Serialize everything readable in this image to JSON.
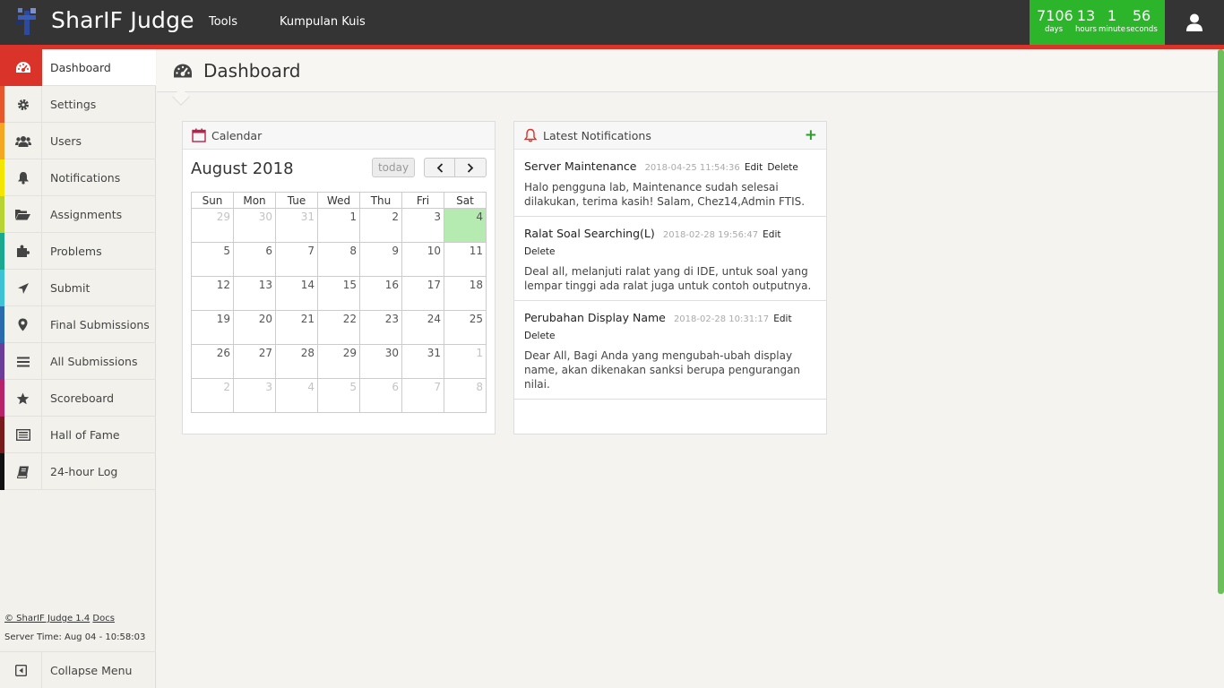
{
  "app": {
    "title": "SharIF Judge",
    "nav": [
      "Tools",
      "Kumpulan Kuis"
    ]
  },
  "countdown": {
    "days": "7106",
    "days_label": "days",
    "hours": "13",
    "hours_label": "hours",
    "minutes": "1",
    "minutes_label": "minute",
    "seconds": "56",
    "seconds_label": "seconds"
  },
  "sidebar": {
    "items": [
      {
        "label": "Dashboard",
        "icon": "dashboard-icon",
        "color": "#d9332a"
      },
      {
        "label": "Settings",
        "icon": "gear-icon",
        "color": "#e8572c"
      },
      {
        "label": "Users",
        "icon": "users-icon",
        "color": "#f5a623"
      },
      {
        "label": "Notifications",
        "icon": "bell-icon",
        "color": "#f4e600"
      },
      {
        "label": "Assignments",
        "icon": "folder-open-icon",
        "color": "#b7d334"
      },
      {
        "label": "Problems",
        "icon": "puzzle-icon",
        "color": "#1aa88f"
      },
      {
        "label": "Submit",
        "icon": "paper-plane-icon",
        "color": "#3ec3d6"
      },
      {
        "label": "Final Submissions",
        "icon": "map-marker-icon",
        "color": "#2a6bb0"
      },
      {
        "label": "All Submissions",
        "icon": "list-icon",
        "color": "#6a3d9a"
      },
      {
        "label": "Scoreboard",
        "icon": "star-icon",
        "color": "#b7226a"
      },
      {
        "label": "Hall of Fame",
        "icon": "newspaper-icon",
        "color": "#7a1b1b"
      },
      {
        "label": "24-hour Log",
        "icon": "book-icon",
        "color": "#111111"
      }
    ],
    "footer_copy": "© SharIF Judge 1.4",
    "footer_docs": "Docs",
    "server_time": "Server Time: Aug 04 - 10:58:03",
    "collapse_label": "Collapse Menu"
  },
  "page": {
    "title": "Dashboard"
  },
  "calendar": {
    "widget_title": "Calendar",
    "month": "August 2018",
    "today_label": "today",
    "weekdays": [
      "Sun",
      "Mon",
      "Tue",
      "Wed",
      "Thu",
      "Fri",
      "Sat"
    ],
    "weeks": [
      [
        "29",
        "30",
        "31",
        "1",
        "2",
        "3",
        "4"
      ],
      [
        "5",
        "6",
        "7",
        "8",
        "9",
        "10",
        "11"
      ],
      [
        "12",
        "13",
        "14",
        "15",
        "16",
        "17",
        "18"
      ],
      [
        "19",
        "20",
        "21",
        "22",
        "23",
        "24",
        "25"
      ],
      [
        "26",
        "27",
        "28",
        "29",
        "30",
        "31",
        "1"
      ],
      [
        "2",
        "3",
        "4",
        "5",
        "6",
        "7",
        "8"
      ]
    ]
  },
  "notifications": {
    "widget_title": "Latest Notifications",
    "add_label": "+",
    "items": [
      {
        "title": "Server Maintenance",
        "date": "2018-04-25 11:54:36",
        "edit": "Edit",
        "delete": "Delete",
        "body": "Halo pengguna lab, Maintenance sudah selesai dilakukan, terima kasih! Salam, Chez14,Admin FTIS."
      },
      {
        "title": "Ralat Soal Searching(L)",
        "date": "2018-02-28 19:56:47",
        "edit": "Edit",
        "delete": "Delete",
        "body": "Deal all, melanjuti ralat yang di IDE, untuk soal yang lempar tinggi ada ralat juga untuk contoh outputnya."
      },
      {
        "title": "Perubahan Display Name",
        "date": "2018-02-28 10:31:17",
        "edit": "Edit",
        "delete": "Delete",
        "body": "Dear All, Bagi Anda yang mengubah-ubah display name, akan dikenakan sanksi berupa pengurangan nilai."
      }
    ]
  }
}
